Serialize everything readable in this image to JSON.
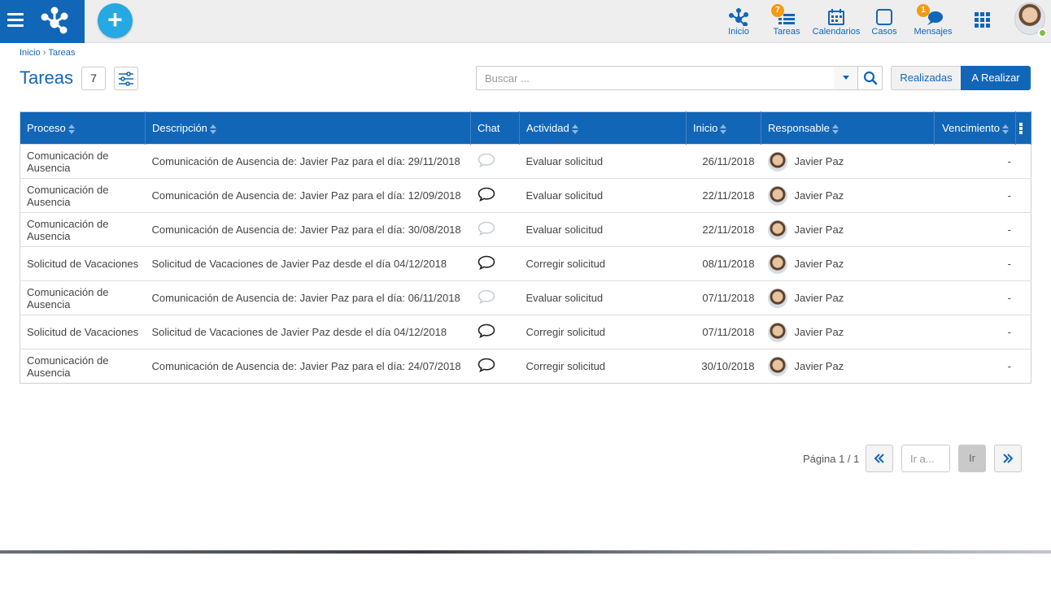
{
  "topbar": {
    "add_symbol": "+",
    "nav": [
      {
        "key": "inicio",
        "label": "Inicio",
        "icon": "process-icon",
        "badge": ""
      },
      {
        "key": "tareas",
        "label": "Tareas",
        "icon": "tasks-icon",
        "badge": "7"
      },
      {
        "key": "calendarios",
        "label": "Calendarios",
        "icon": "calendar-icon",
        "badge": ""
      },
      {
        "key": "casos",
        "label": "Casos",
        "icon": "case-square-icon",
        "badge": ""
      },
      {
        "key": "mensajes",
        "label": "Mensajes",
        "icon": "chat-bubbles-icon",
        "badge": "1"
      }
    ]
  },
  "breadcrumb": {
    "home": "Inicio",
    "separator": "›",
    "current": "Tareas"
  },
  "page": {
    "title": "Tareas",
    "count": "7"
  },
  "search": {
    "placeholder": "Buscar ..."
  },
  "toggle": {
    "done_label": "Realizadas",
    "todo_label": "A Realizar"
  },
  "table": {
    "columns": {
      "proceso": "Proceso",
      "descripcion": "Descripción",
      "chat": "Chat",
      "actividad": "Actividad",
      "inicio": "Inicio",
      "responsable": "Responsable",
      "vencimiento": "Vencimiento"
    },
    "rows": [
      {
        "proceso": "Comunicación de Ausencia",
        "descripcion": "Comunicación de Ausencia de: Javier Paz para el día: 29/11/2018",
        "chat_active": false,
        "actividad": "Evaluar solicitud",
        "inicio": "26/11/2018",
        "responsable": "Javier Paz",
        "vencimiento": "-"
      },
      {
        "proceso": "Comunicación de Ausencia",
        "descripcion": "Comunicación de Ausencia de: Javier Paz para el día: 12/09/2018",
        "chat_active": true,
        "actividad": "Evaluar solicitud",
        "inicio": "22/11/2018",
        "responsable": "Javier Paz",
        "vencimiento": "-"
      },
      {
        "proceso": "Comunicación de Ausencia",
        "descripcion": "Comunicación de Ausencia de: Javier Paz para el día: 30/08/2018",
        "chat_active": false,
        "actividad": "Evaluar solicitud",
        "inicio": "22/11/2018",
        "responsable": "Javier Paz",
        "vencimiento": "-"
      },
      {
        "proceso": "Solicitud de Vacaciones",
        "descripcion": "Solicitud de Vacaciones de Javier Paz desde el día 04/12/2018",
        "chat_active": true,
        "actividad": "Corregir solicitud",
        "inicio": "08/11/2018",
        "responsable": "Javier Paz",
        "vencimiento": "-"
      },
      {
        "proceso": "Comunicación de Ausencia",
        "descripcion": "Comunicación de Ausencia de: Javier Paz para el día: 06/11/2018",
        "chat_active": false,
        "actividad": "Evaluar solicitud",
        "inicio": "07/11/2018",
        "responsable": "Javier Paz",
        "vencimiento": "-"
      },
      {
        "proceso": "Solicitud de Vacaciones",
        "descripcion": "Solicitud de Vacaciones de Javier Paz desde el día 04/12/2018",
        "chat_active": true,
        "actividad": "Corregir solicitud",
        "inicio": "07/11/2018",
        "responsable": "Javier Paz",
        "vencimiento": "-"
      },
      {
        "proceso": "Comunicación de Ausencia",
        "descripcion": "Comunicación de Ausencia de: Javier Paz para el día: 24/07/2018",
        "chat_active": true,
        "actividad": "Corregir solicitud",
        "inicio": "30/10/2018",
        "responsable": "Javier Paz",
        "vencimiento": "-"
      }
    ]
  },
  "pagination": {
    "label": "Página 1 / 1",
    "goto_placeholder": "Ir a...",
    "go_label": "Ir"
  },
  "colors": {
    "brand": "#1266b8",
    "accent": "#26a8e3",
    "badge": "#f39a16",
    "online": "#7ac143"
  }
}
